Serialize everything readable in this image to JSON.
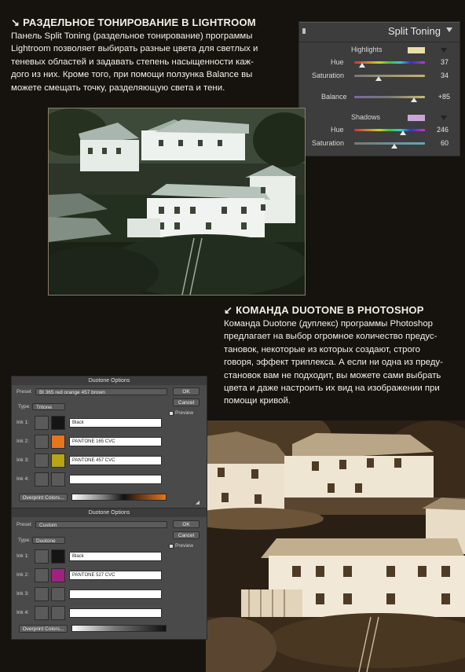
{
  "section1": {
    "arrow": "↘",
    "heading": "РАЗДЕЛЬНОЕ ТОНИРОВАНИЕ В LIGHTROOM",
    "lines": [
      "Панель Split Toning (раздельное тонирование) программы",
      "Lightroom позволяет выбирать разные цвета для светлых и",
      "теневых областей и задавать степень насыщенности каж-",
      "дого из них. Кроме того, при помощи ползунка Balance вы",
      "можете смещать точку, разделяющую света и тени."
    ]
  },
  "lightroom": {
    "title": "Split Toning",
    "highlights_label": "Highlights",
    "highlights_color": "#e8dfaa",
    "shadows_label": "Shadows",
    "shadows_color": "#c9a6d8",
    "hue_label": "Hue",
    "sat_label": "Saturation",
    "balance_label": "Balance",
    "h_hue": "37",
    "h_sat": "34",
    "balance": "+85",
    "s_hue": "246",
    "s_sat": "60"
  },
  "section2": {
    "arrow": "↙",
    "heading": "КОМАНДА DUOTONE В PHOTOSHOP",
    "lines": [
      "Команда Duotone (дуплекс) программы Photoshop",
      "предлагает на выбор огромное количество предус-",
      "тановок, некоторые из которых создают, строго",
      "говоря, эффект триплекса. А если ни одна из преду-",
      "становок вам не подходит, вы можете сами выбрать",
      "цвета и даже настроить их вид на изображении при",
      "помощи кривой."
    ]
  },
  "dialog1": {
    "title": "Duotone Options",
    "preset_label": "Preset",
    "preset_value": "Bl 365 red orange 457 brown",
    "type_label": "Type:",
    "type_value": "Tritone",
    "ok": "OK",
    "cancel": "Cancel",
    "preview": "Preview",
    "ink1": "Ink 1:",
    "ink1_name": "Black",
    "ink1_color": "#151515",
    "ink2": "Ink 2:",
    "ink2_name": "PANTONE 165 CVC",
    "ink2_color": "#e8741c",
    "ink3": "Ink 3:",
    "ink3_name": "PANTONE 457 CVC",
    "ink3_color": "#b7a516",
    "ink4": "Ink 4:",
    "ink4_name": "",
    "overprint": "Overprint Colors..."
  },
  "dialog2": {
    "title": "Duotone Options",
    "preset_label": "Preset",
    "preset_value": "Custom",
    "type_label": "Type:",
    "type_value": "Duotone",
    "ok": "OK",
    "cancel": "Cancel",
    "preview": "Preview",
    "ink1": "Ink 1:",
    "ink1_name": "Black",
    "ink1_color": "#151515",
    "ink2": "Ink 2:",
    "ink2_name": "PANTONE 527 CVC",
    "ink2_color": "#a0227f",
    "ink3": "Ink 3:",
    "ink3_name": "",
    "ink4": "Ink 4:",
    "ink4_name": "",
    "overprint": "Overprint Colors..."
  }
}
